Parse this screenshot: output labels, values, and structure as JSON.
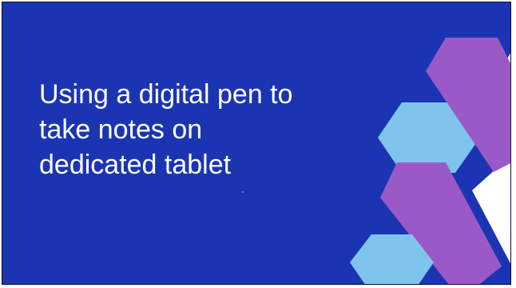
{
  "slide": {
    "title_lines": [
      "Using a digital pen to",
      "take notes on",
      "dedicated tablet"
    ],
    "background_color": "#1b35b2",
    "accent_colors": {
      "purple": "#9b59c8",
      "light_blue": "#7ec4ec",
      "white": "#ffffff"
    }
  }
}
